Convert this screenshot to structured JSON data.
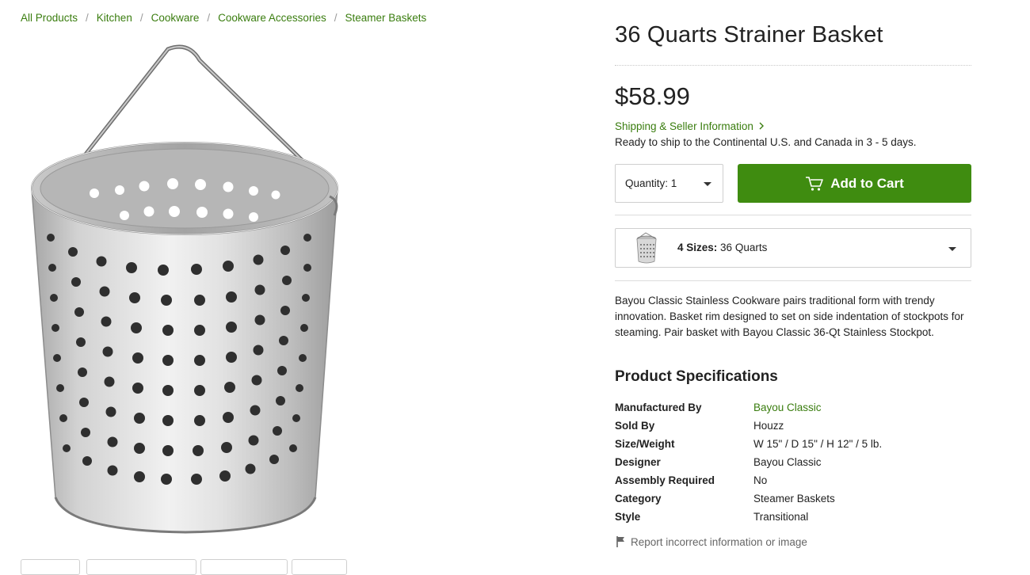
{
  "breadcrumb": [
    {
      "label": "All Products"
    },
    {
      "label": "Kitchen"
    },
    {
      "label": "Cookware"
    },
    {
      "label": "Cookware Accessories"
    },
    {
      "label": "Steamer Baskets"
    }
  ],
  "breadcrumb_separator": "/",
  "product": {
    "title": "36 Quarts Strainer Basket",
    "price": "$58.99",
    "shipping_link": "Shipping & Seller Information",
    "shipping_note": "Ready to ship to the Continental U.S. and Canada in 3 - 5 days.",
    "quantity_label": "Quantity: 1",
    "add_to_cart": "Add to Cart",
    "sizes_count": "4 Sizes:",
    "sizes_selected": "36 Quarts",
    "description": "Bayou Classic Stainless Cookware pairs traditional form with trendy innovation. Basket rim designed to set on side indentation of stockpots for steaming. Pair basket with Bayou Classic 36-Qt Stainless Stockpot."
  },
  "specs": {
    "heading": "Product Specifications",
    "rows": [
      {
        "key": "Manufactured By",
        "value": "Bayou Classic"
      },
      {
        "key": "Sold By",
        "value": "Houzz"
      },
      {
        "key": "Size/Weight",
        "value": "W 15\" / D 15\" / H 12\" / 5 lb."
      },
      {
        "key": "Designer",
        "value": "Bayou Classic"
      },
      {
        "key": "Assembly Required",
        "value": "No"
      },
      {
        "key": "Category",
        "value": "Steamer Baskets"
      },
      {
        "key": "Style",
        "value": "Transitional"
      }
    ]
  },
  "report_link": "Report incorrect information or image",
  "colors": {
    "link_green": "#3a7d0f",
    "cart_green": "#3f8c10",
    "text": "#222222"
  },
  "icons": [
    "chevron-right-icon",
    "chevron-down-icon",
    "cart-icon",
    "flag-icon"
  ]
}
